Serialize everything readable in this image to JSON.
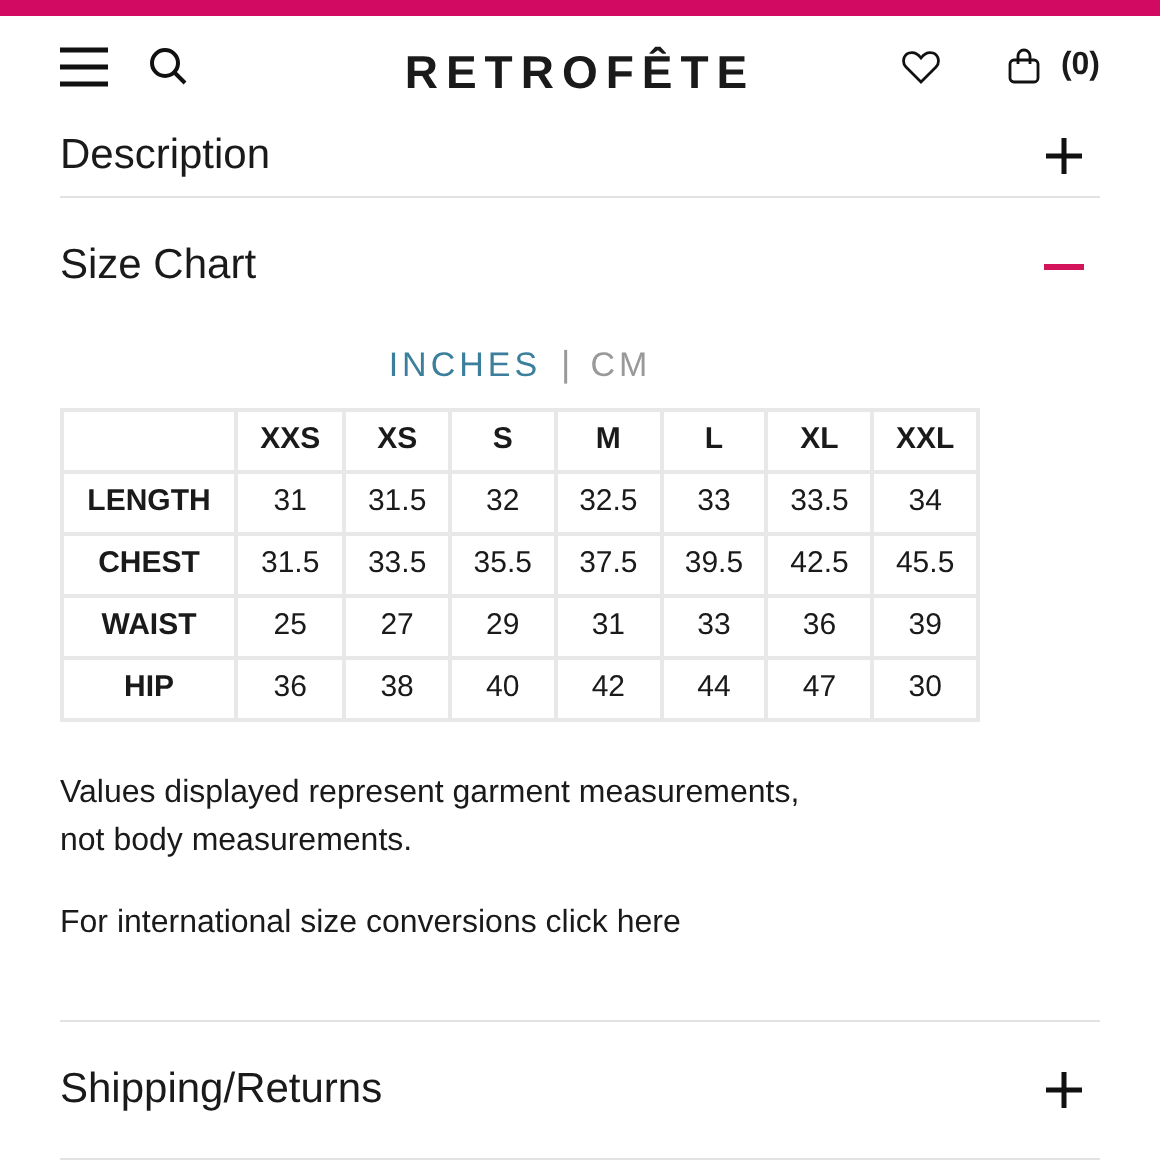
{
  "header": {
    "logo": "RETROFÊTE",
    "cart_count": "(0)"
  },
  "sections": [
    {
      "title": "Description",
      "expanded": false
    },
    {
      "title": "Size Chart",
      "expanded": true,
      "units": [
        {
          "label": "INCHES",
          "selected": true
        },
        {
          "label": "CM",
          "selected": false
        }
      ],
      "unit_separator": "|",
      "table": {
        "columns": [
          "XXS",
          "XS",
          "S",
          "M",
          "L",
          "XL",
          "XXL"
        ],
        "rows": [
          {
            "label": "LENGTH",
            "values": [
              "31",
              "31.5",
              "32",
              "32.5",
              "33",
              "33.5",
              "34"
            ]
          },
          {
            "label": "CHEST",
            "values": [
              "31.5",
              "33.5",
              "35.5",
              "37.5",
              "39.5",
              "42.5",
              "45.5"
            ]
          },
          {
            "label": "WAIST",
            "values": [
              "25",
              "27",
              "29",
              "31",
              "33",
              "36",
              "39"
            ]
          },
          {
            "label": "HIP",
            "values": [
              "36",
              "38",
              "40",
              "42",
              "44",
              "47",
              "30"
            ]
          }
        ]
      },
      "note": "Values displayed represent garment measurements, not body measurements.",
      "link": "For international size conversions click here"
    },
    {
      "title": "Shipping/Returns",
      "expanded": false
    }
  ]
}
